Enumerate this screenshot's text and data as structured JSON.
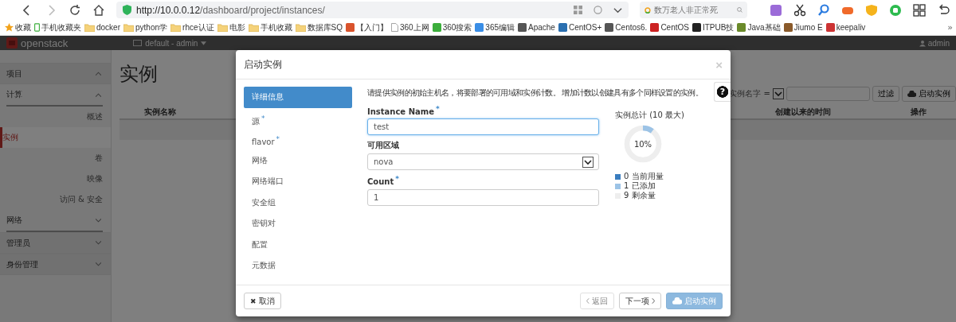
{
  "browser": {
    "url_host": "http://10.0.0.12",
    "url_path": "/dashboard/project/instances/",
    "search_placeholder": "数万老人非正常死",
    "bookmarks": [
      {
        "kind": "star",
        "label": "收藏"
      },
      {
        "kind": "phone",
        "label": "手机收藏夹"
      },
      {
        "kind": "folder",
        "label": "docker"
      },
      {
        "kind": "folder",
        "label": "python学"
      },
      {
        "kind": "folder",
        "label": "rhce认证"
      },
      {
        "kind": "folder",
        "label": "电影"
      },
      {
        "kind": "folder",
        "label": "手机收藏"
      },
      {
        "kind": "folder",
        "label": "数据库SQ"
      },
      {
        "kind": "site",
        "label": "【入门】",
        "color": "#d9532c"
      },
      {
        "kind": "page",
        "label": "360上网"
      },
      {
        "kind": "site",
        "label": "360搜索",
        "color": "#3cae3c"
      },
      {
        "kind": "site",
        "label": "365编辑",
        "color": "#3a8ee6"
      },
      {
        "kind": "site",
        "label": "Apache",
        "color": "#555555"
      },
      {
        "kind": "site",
        "label": "CentOS+",
        "color": "#2a6fb0"
      },
      {
        "kind": "site",
        "label": "Centos6.",
        "color": "#555555"
      },
      {
        "kind": "site",
        "label": "CentOS",
        "color": "#cc2222"
      },
      {
        "kind": "site",
        "label": "ITPUB技",
        "color": "#222222"
      },
      {
        "kind": "site",
        "label": "Java基础",
        "color": "#6a8a2a"
      },
      {
        "kind": "site",
        "label": "Jiumo E",
        "color": "#8a5a2a"
      },
      {
        "kind": "site",
        "label": "keepaliv",
        "color": "#cc3333"
      }
    ],
    "more": "»"
  },
  "topbar": {
    "logo": "openstack",
    "project_menu": "default - admin",
    "user": "admin"
  },
  "sidebar": [
    {
      "label": "项目",
      "expanded": true,
      "children": [
        {
          "label": "计算",
          "expanded": true,
          "children": [
            {
              "label": "概述",
              "selected": false
            },
            {
              "label": "实例",
              "selected": true
            },
            {
              "label": "卷",
              "selected": false
            },
            {
              "label": "映像",
              "selected": false
            },
            {
              "label": "访问 & 安全",
              "selected": false
            }
          ]
        },
        {
          "label": "网络",
          "expanded": false
        }
      ]
    },
    {
      "label": "管理员",
      "expanded": false
    },
    {
      "label": "身份管理",
      "expanded": false
    }
  ],
  "page": {
    "title": "实例",
    "filter_field": "实例名字 =",
    "filter_button": "过滤",
    "launch_button": "启动实例",
    "columns": [
      "实例名称",
      "创建以来的时间",
      "操作"
    ]
  },
  "modal": {
    "title": "启动实例",
    "close": "×",
    "help": "?",
    "required_mark": "*",
    "cancel_icon": "✖",
    "steps": [
      {
        "label": "详细信息",
        "required": false,
        "selected": true
      },
      {
        "label": "源",
        "required": true,
        "selected": false
      },
      {
        "label": "flavor",
        "required": true,
        "selected": false
      },
      {
        "label": "网络",
        "required": false,
        "selected": false
      },
      {
        "label": "网络端口",
        "required": false,
        "selected": false
      },
      {
        "label": "安全组",
        "required": false,
        "selected": false
      },
      {
        "label": "密钥对",
        "required": false,
        "selected": false
      },
      {
        "label": "配置",
        "required": false,
        "selected": false
      },
      {
        "label": "元数据",
        "required": false,
        "selected": false
      }
    ],
    "description": "请提供实例的初始主机名，将要部署的可用域和实例计数。 增加计数以创建具有多个同样设置的实例。",
    "fields": [
      {
        "kind": "text",
        "label": "Instance Name",
        "required": true,
        "value": "test",
        "focused": true
      },
      {
        "kind": "select",
        "label": "可用区域",
        "required": false,
        "value": "nova",
        "focused": false
      },
      {
        "kind": "text",
        "label": "Count",
        "required": true,
        "value": "1",
        "focused": false
      }
    ],
    "summary": {
      "title": "实例总计 (10 最大)",
      "level": 0.1,
      "percent": "10%",
      "legend": [
        {
          "count": "0",
          "label": "当前用量",
          "color": "#3a7dbf"
        },
        {
          "count": "1",
          "label": "已添加",
          "color": "#9cc3e6"
        },
        {
          "count": "9",
          "label": "剩余量",
          "color": "#eeeeee"
        }
      ]
    },
    "cancel": "取消",
    "back": {
      "label": "返回",
      "disabled": true
    },
    "next": {
      "label": "下一项",
      "disabled": false
    },
    "launch": {
      "label": "启动实例",
      "disabled": true
    }
  }
}
